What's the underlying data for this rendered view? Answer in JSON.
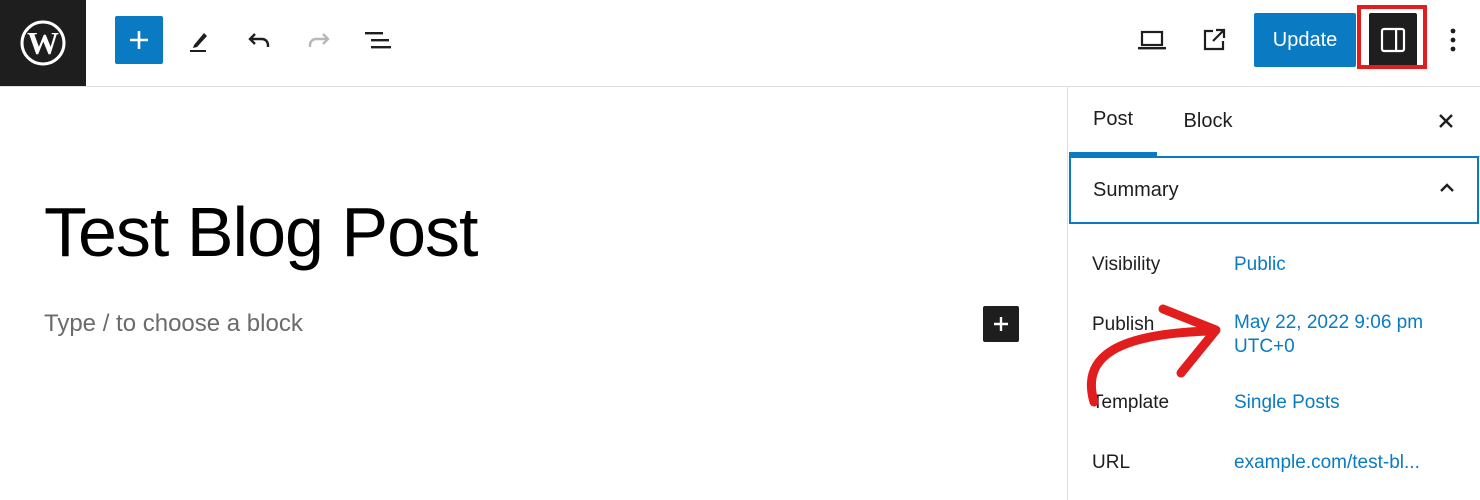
{
  "toolbar": {
    "logo_icon": "wordpress-logo",
    "add_icon": "plus-icon",
    "tools_icon": "pencil-icon",
    "undo_icon": "undo-icon",
    "redo_icon": "redo-icon",
    "list_view_icon": "list-view-icon",
    "preview_icon": "laptop-icon",
    "view_post_icon": "external-link-icon",
    "update_label": "Update",
    "settings_icon": "sidebar-toggle-icon",
    "more_icon": "more-vertical-icon"
  },
  "editor": {
    "post_title": "Test Blog Post",
    "block_placeholder": "Type / to choose a block"
  },
  "sidebar": {
    "tabs": [
      {
        "label": "Post",
        "active": true
      },
      {
        "label": "Block",
        "active": false
      }
    ],
    "summary": {
      "title": "Summary",
      "rows": {
        "visibility": {
          "label": "Visibility",
          "value": "Public"
        },
        "publish": {
          "label": "Publish",
          "value_line1": "May 22, 2022 9:06 pm",
          "value_line2": "UTC+0"
        },
        "template": {
          "label": "Template",
          "value": "Single Posts"
        },
        "url": {
          "label": "URL",
          "value": "example.com/test-bl..."
        }
      }
    }
  },
  "colors": {
    "accent": "#0a7bc2",
    "dark": "#1e1e1e",
    "annotation": "#e11d1d"
  }
}
